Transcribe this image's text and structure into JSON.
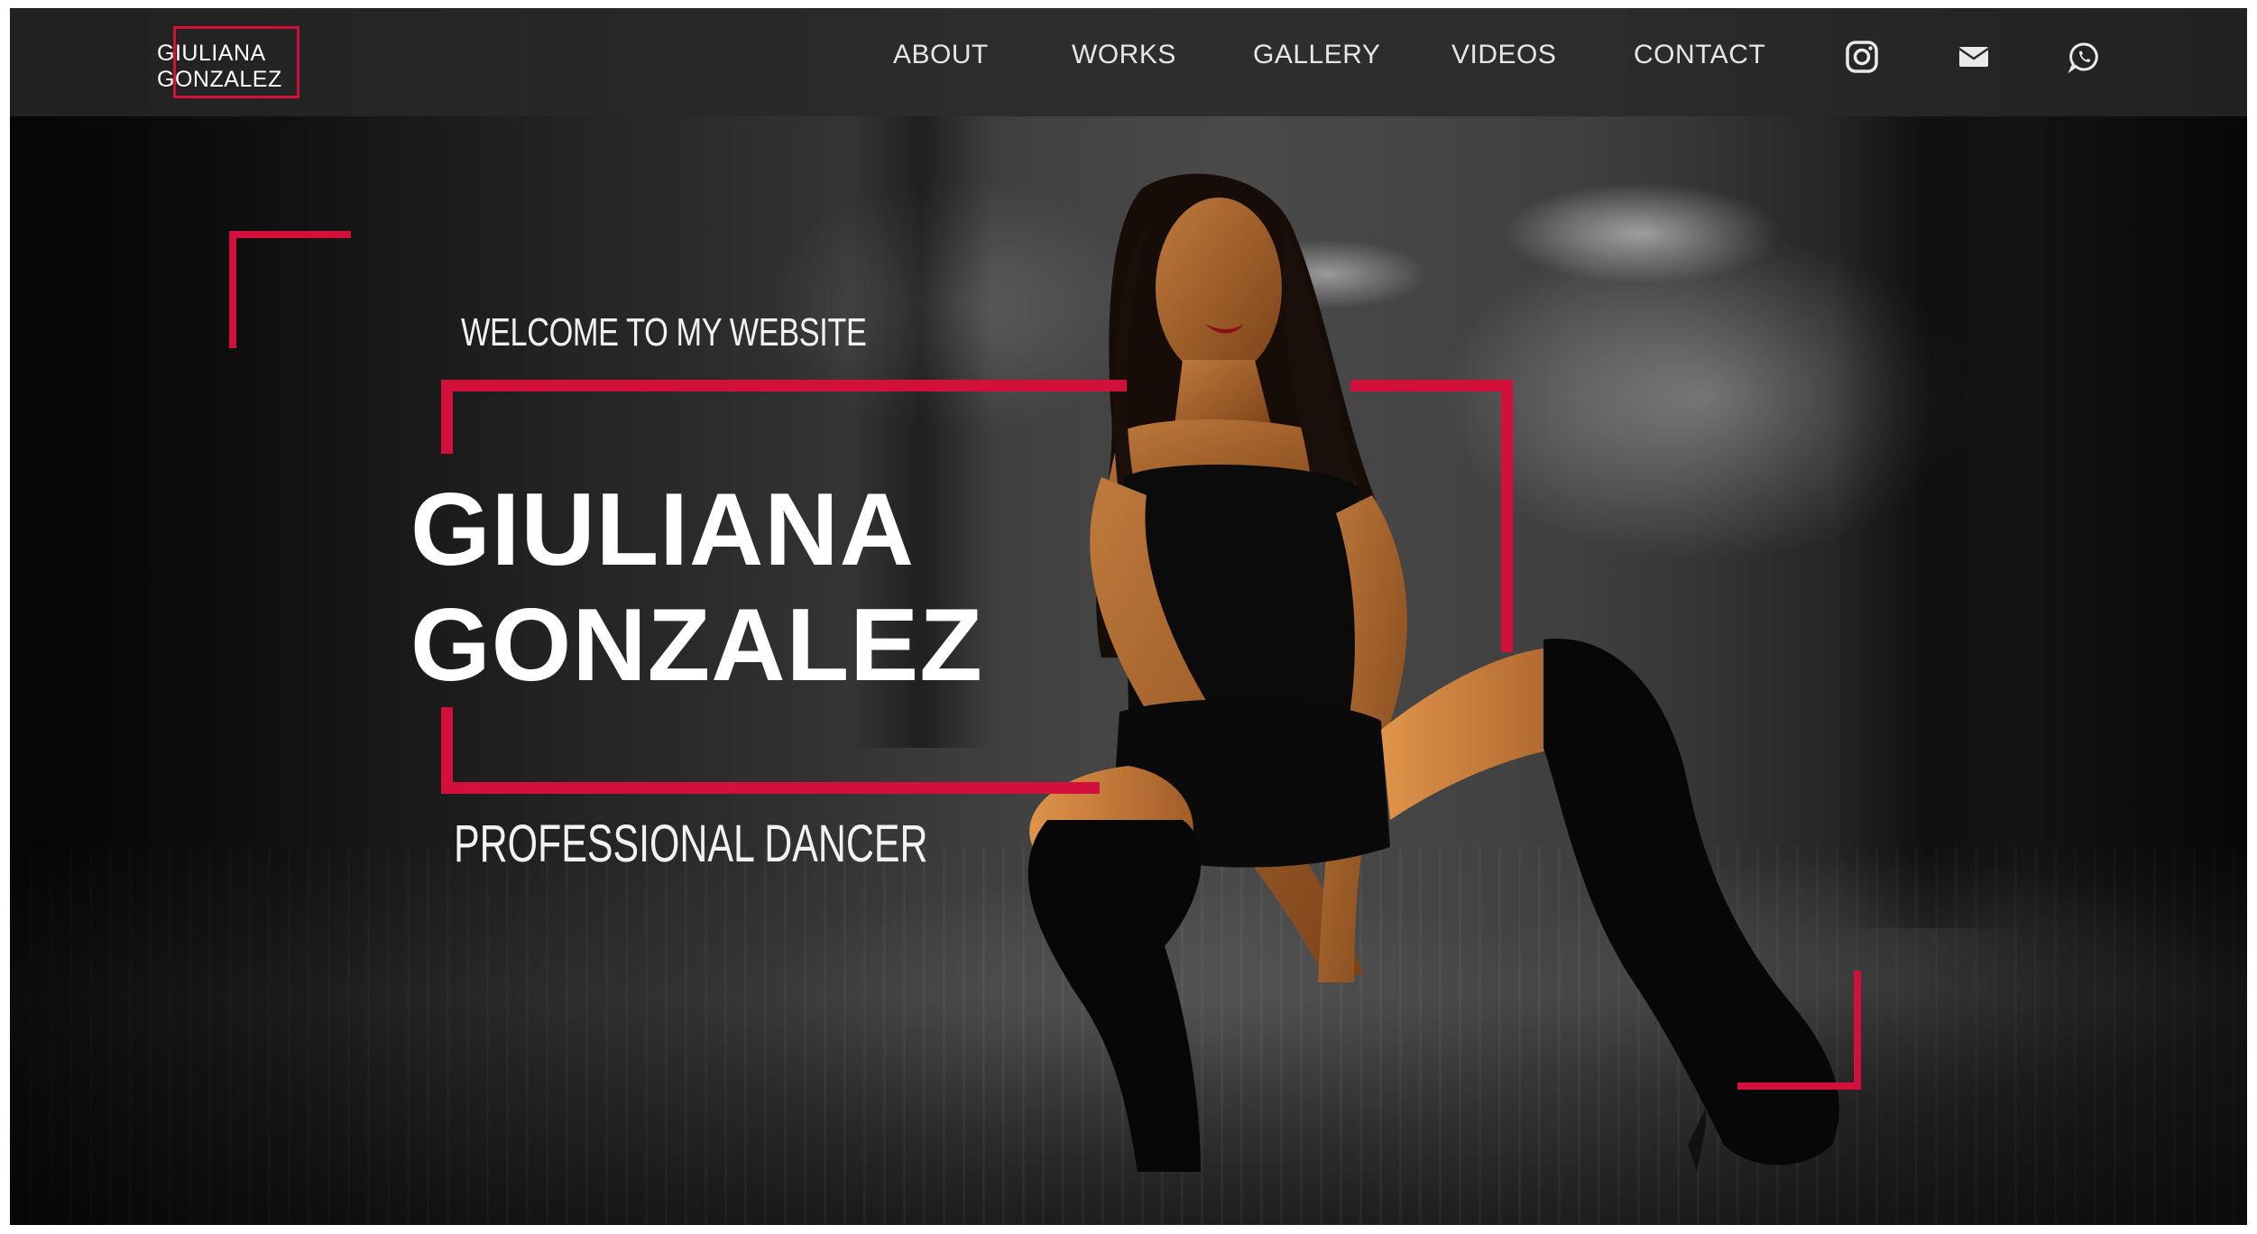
{
  "brand": {
    "logo_text": "GIULIANA\nGONZALEZ",
    "accent_color": "#d3103c"
  },
  "nav": {
    "links": [
      {
        "label": "ABOUT"
      },
      {
        "label": "WORKS"
      },
      {
        "label": "GALLERY"
      },
      {
        "label": "VIDEOS"
      },
      {
        "label": "CONTACT"
      }
    ],
    "icons": [
      "instagram-icon",
      "mail-icon",
      "whatsapp-icon"
    ]
  },
  "hero": {
    "welcome": "WELCOME TO MY WEBSITE",
    "name_line1": "GIULIANA",
    "name_line2": "GONZALEZ",
    "subtitle": "PROFESSIONAL DANCER"
  }
}
